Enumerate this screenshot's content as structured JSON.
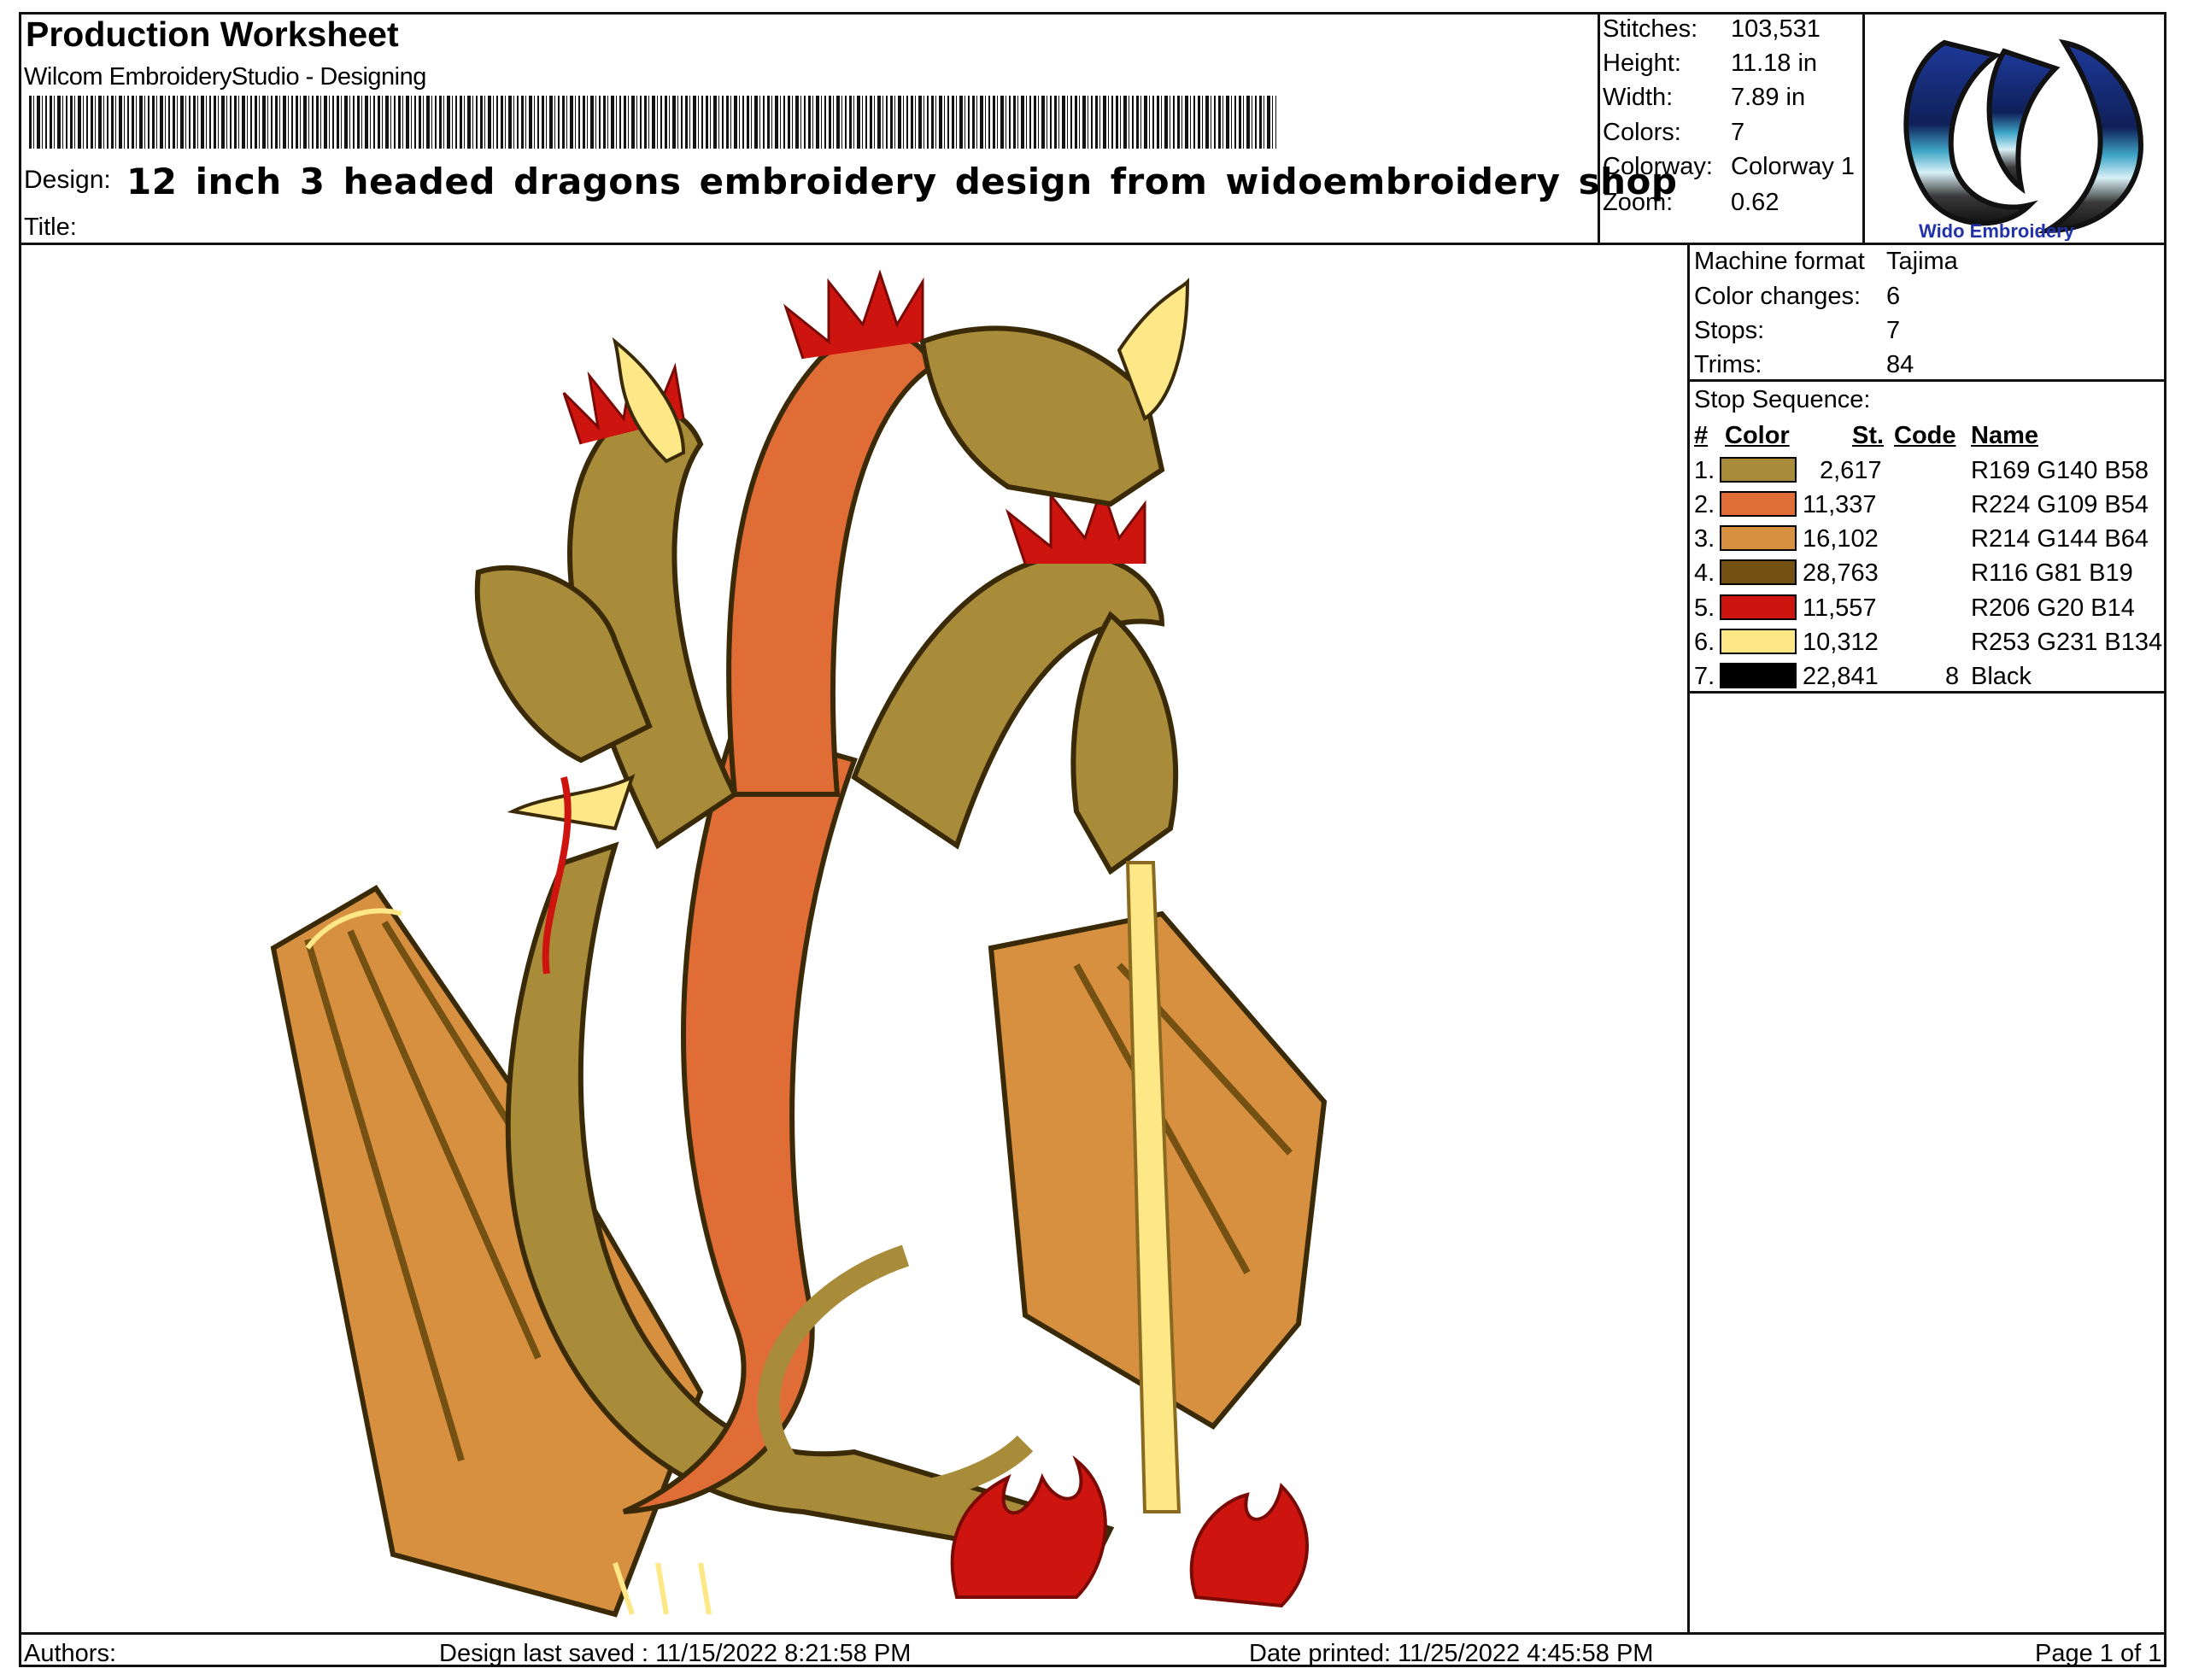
{
  "worksheet_title": "Production Worksheet",
  "software": "Wilcom EmbroideryStudio - Designing",
  "design_label": "Design:",
  "design_name": "12 inch 3 headed dragons embroidery design from widoembroidery shop",
  "title_label": "Title:",
  "stats": [
    {
      "label": "Stitches:",
      "value": "103,531"
    },
    {
      "label": "Height:",
      "value": "11.18 in"
    },
    {
      "label": "Width:",
      "value": "7.89 in"
    },
    {
      "label": "Colors:",
      "value": "7"
    },
    {
      "label": "Colorway:",
      "value": "Colorway 1"
    },
    {
      "label": "Zoom:",
      "value": "0.62"
    }
  ],
  "machine": [
    {
      "label": "Machine format",
      "value": "Tajima"
    },
    {
      "label": "Color changes:",
      "value": "6"
    },
    {
      "label": "Stops:",
      "value": "7"
    },
    {
      "label": "Trims:",
      "value": "84"
    }
  ],
  "stop_sequence_label": "Stop Sequence:",
  "table_headers": {
    "num": "#",
    "color": "Color",
    "st": "St.",
    "code": "Code",
    "name": "Name"
  },
  "rows": [
    {
      "num": "1.",
      "color": "#A98C3A",
      "st": "2,617",
      "code": "",
      "name": "R169 G140 B58"
    },
    {
      "num": "2.",
      "color": "#E06D36",
      "st": "11,337",
      "code": "",
      "name": "R224 G109 B54"
    },
    {
      "num": "3.",
      "color": "#D69040",
      "st": "16,102",
      "code": "",
      "name": "R214 G144 B64"
    },
    {
      "num": "4.",
      "color": "#745113",
      "st": "28,763",
      "code": "",
      "name": "R116 G81 B19"
    },
    {
      "num": "5.",
      "color": "#CE140E",
      "st": "11,557",
      "code": "",
      "name": "R206 G20 B14"
    },
    {
      "num": "6.",
      "color": "#FDE786",
      "st": "10,312",
      "code": "",
      "name": "R253 G231 B134"
    },
    {
      "num": "7.",
      "color": "#000000",
      "st": "22,841",
      "code": "8",
      "name": "Black"
    }
  ],
  "footer": {
    "authors": "Authors:",
    "saved": "Design last saved : 11/15/2022 8:21:58 PM",
    "printed": "Date printed: 11/25/2022 4:45:58 PM",
    "page": "Page 1 of 1"
  },
  "logo_letters": "W",
  "logo_text": "Wido Embroidery"
}
